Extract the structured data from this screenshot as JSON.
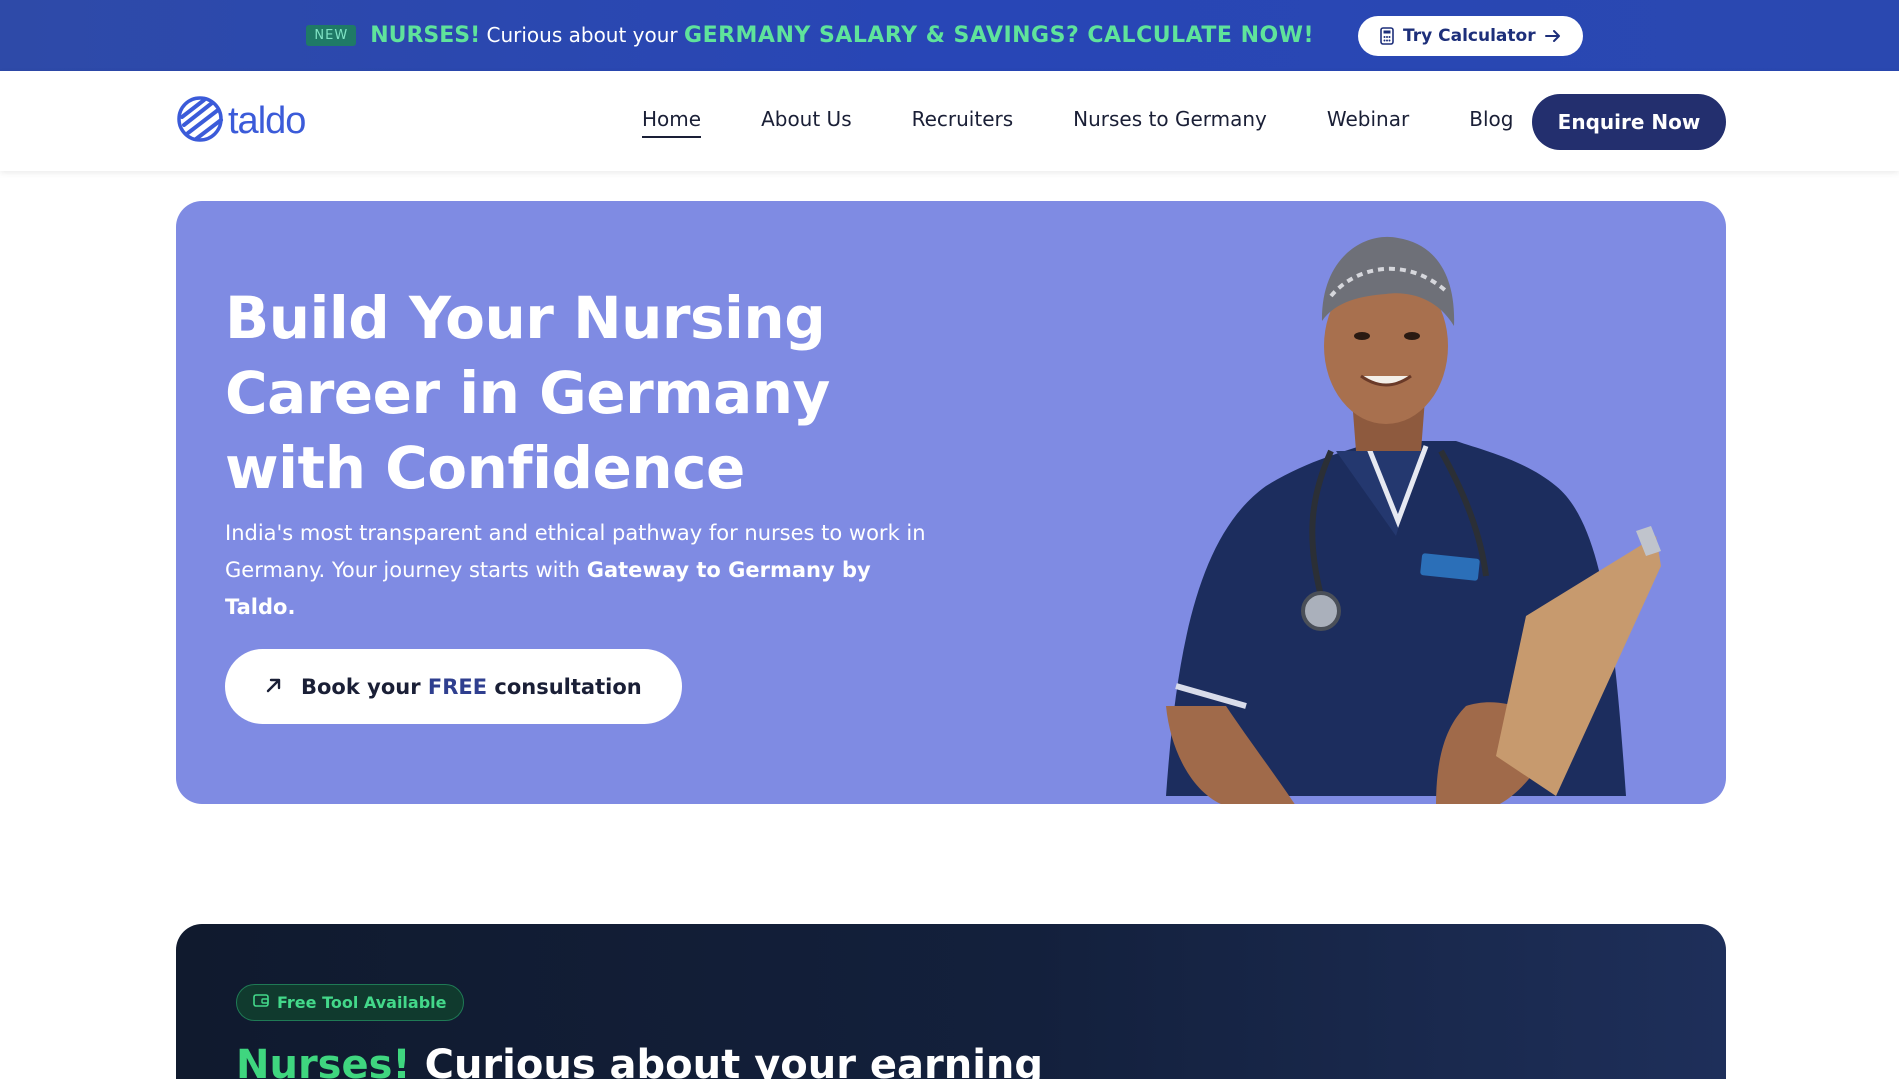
{
  "promo": {
    "badge": "NEW",
    "nurses": "NURSES!",
    "middle": " Curious about your ",
    "highlight": "GERMANY SALARY & SAVINGS? CALCULATE NOW!",
    "button_label": "Try Calculator"
  },
  "nav": {
    "logo_text": "taldo",
    "items": [
      {
        "label": "Home",
        "active": true
      },
      {
        "label": "About Us"
      },
      {
        "label": "Recruiters"
      },
      {
        "label": "Nurses to Germany"
      },
      {
        "label": "Webinar"
      },
      {
        "label": "Blog"
      }
    ],
    "cta": "Enquire Now"
  },
  "hero": {
    "title": "Build Your Nursing Career in Germany with Confidence",
    "subtitle_start": "India's most transparent and ethical pathway for nurses to work in Germany. Your journey starts with ",
    "subtitle_bold": "Gateway to Germany by Taldo.",
    "cta_prefix": "Book your ",
    "cta_free": "FREE",
    "cta_suffix": " consultation"
  },
  "tool_section": {
    "badge": "Free Tool Available",
    "heading_green": "Nurses!",
    "heading_rest": " Curious about your earning"
  },
  "colors": {
    "banner": "#2846b6",
    "accent_green": "#5fe39b",
    "hero_bg": "#7f8be3",
    "enquire_bg": "#232f6e",
    "dark_bg": "#101a2e"
  }
}
